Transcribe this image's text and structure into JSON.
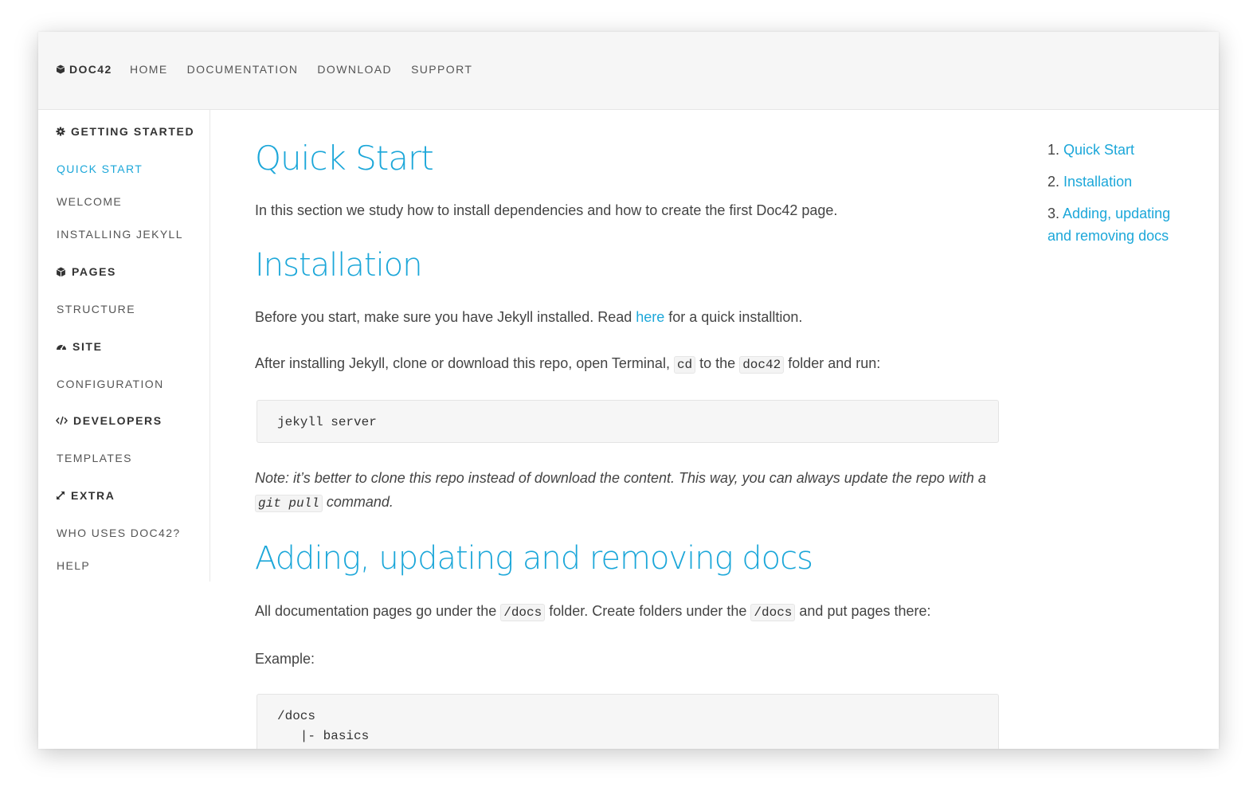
{
  "brand": {
    "name": "DOC42",
    "icon": "cube-icon"
  },
  "topnav": [
    "HOME",
    "DOCUMENTATION",
    "DOWNLOAD",
    "SUPPORT"
  ],
  "sidebar": {
    "sections": [
      {
        "title": "GETTING STARTED",
        "icon": "gear-icon",
        "items": [
          "QUICK START",
          "WELCOME",
          "INSTALLING JEKYLL"
        ]
      },
      {
        "title": "PAGES",
        "icon": "cube-icon",
        "items": [
          "STRUCTURE"
        ]
      },
      {
        "title": "SITE",
        "icon": "dashboard-icon",
        "items": [
          "CONFIGURATION"
        ]
      },
      {
        "title": "DEVELOPERS",
        "icon": "code-icon",
        "items": [
          "TEMPLATES"
        ]
      },
      {
        "title": "EXTRA",
        "icon": "expand-icon",
        "items": [
          "WHO USES DOC42?",
          "HELP"
        ]
      }
    ],
    "active_item": "QUICK START"
  },
  "content": {
    "h_quick_start": "Quick Start",
    "p_intro": "In this section we study how to install dependencies and how to create the first Doc42 page.",
    "h_installation": "Installation",
    "p_before_1": "Before you start, make sure you have Jekyll installed. Read ",
    "p_before_link": "here",
    "p_before_2": " for a quick installtion.",
    "p_after_1": "After installing Jekyll, clone or download this repo, open Terminal, ",
    "p_after_code1": "cd",
    "p_after_2": " to the ",
    "p_after_code2": "doc42",
    "p_after_3": " folder and run:",
    "code_serve": "jekyll server",
    "note_1": "Note: it’s better to clone this repo instead of download the content. This way, you can always update the repo with a ",
    "note_code": "git pull",
    "note_2": " command.",
    "h_adding": "Adding, updating and removing docs",
    "p_docs_1": "All documentation pages go under the ",
    "p_docs_code1": "/docs",
    "p_docs_2": " folder. Create folders under the ",
    "p_docs_code2": "/docs",
    "p_docs_3": " and put pages there:",
    "p_example": "Example:",
    "code_example": [
      "/docs",
      "   |- basics"
    ]
  },
  "toc": [
    {
      "num": "1.",
      "label": "Quick Start"
    },
    {
      "num": "2.",
      "label": "Installation"
    },
    {
      "num": "3.",
      "label_1": "Adding, updating",
      "label_2": "and removing docs"
    }
  ],
  "colors": {
    "accent": "#1ca7d9",
    "topbar_bg": "#f6f6f6",
    "text": "#444444"
  }
}
